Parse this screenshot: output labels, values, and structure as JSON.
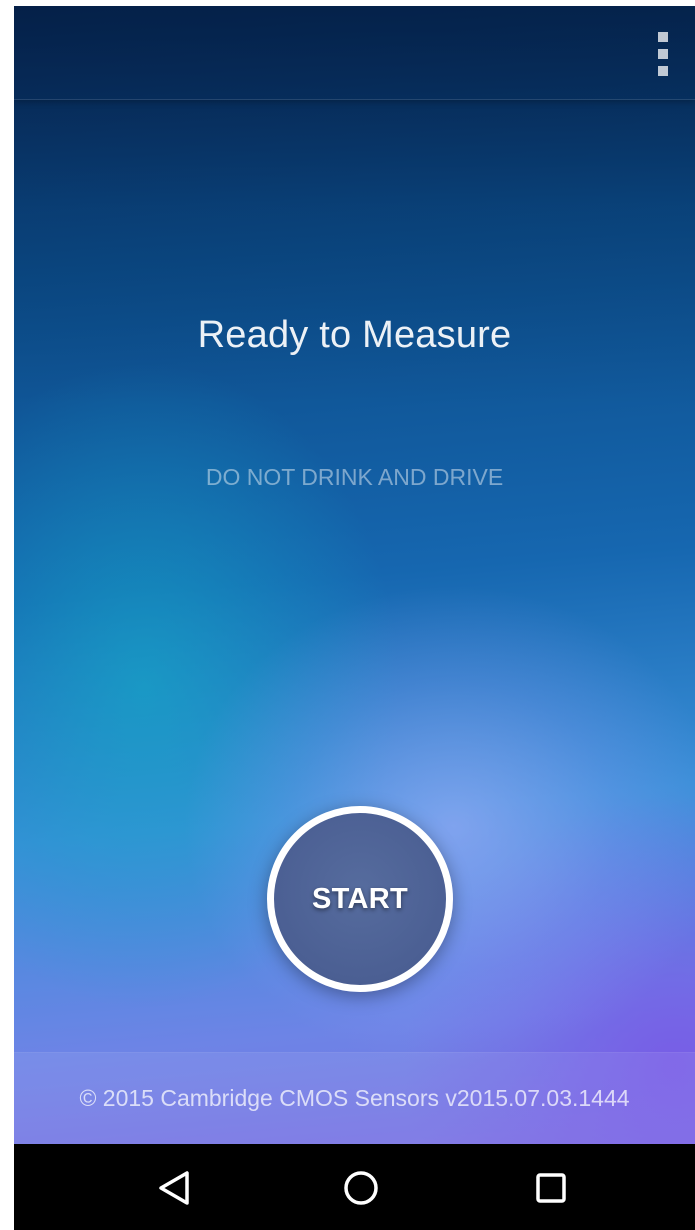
{
  "app_bar": {
    "menu_icon": "overflow-menu-icon"
  },
  "main": {
    "headline": "Ready to Measure",
    "warning": "DO NOT DRINK AND DRIVE",
    "start_label": "START"
  },
  "footer": {
    "copyright": "© 2015 Cambridge CMOS Sensors v2015.07.03.1444"
  },
  "nav": {
    "back_icon": "back-triangle-icon",
    "home_icon": "home-circle-icon",
    "recents_icon": "recents-square-icon"
  },
  "colors": {
    "background_top": "#0a2f63",
    "background_mid": "#1667b0",
    "background_bottom": "#7a6fe3",
    "start_button_fill": "#4b5f93",
    "start_button_ring": "#ffffff",
    "nav_bar": "#000000"
  }
}
